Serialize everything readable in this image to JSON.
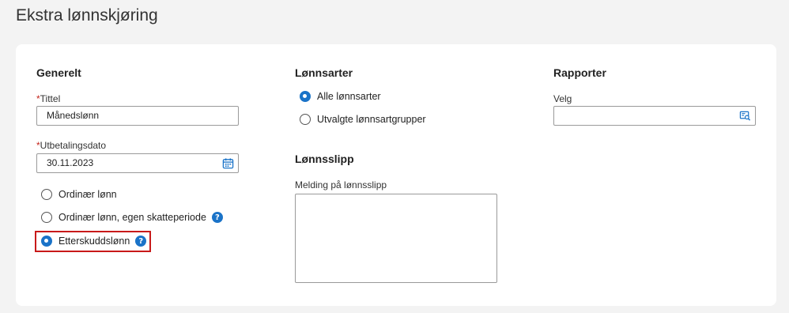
{
  "page": {
    "title": "Ekstra lønnskjøring"
  },
  "generelt": {
    "heading": "Generelt",
    "tittel": {
      "required_mark": "*",
      "label": "Tittel",
      "value": "Månedslønn"
    },
    "utbetalingsdato": {
      "required_mark": "*",
      "label": "Utbetalingsdato",
      "value": "30.11.2023",
      "icon": "calendar-icon"
    },
    "pay_types": [
      {
        "label": "Ordinær lønn",
        "checked": false,
        "help": false
      },
      {
        "label": "Ordinær lønn, egen skatteperiode",
        "checked": false,
        "help": true
      },
      {
        "label": "Etterskuddslønn",
        "checked": true,
        "help": true
      }
    ],
    "help_glyph": "?"
  },
  "lonnsarter": {
    "heading": "Lønnsarter",
    "options": [
      {
        "label": "Alle lønnsarter",
        "checked": true
      },
      {
        "label": "Utvalgte lønnsartgrupper",
        "checked": false
      }
    ]
  },
  "lonnsslipp": {
    "heading": "Lønnsslipp",
    "message_label": "Melding på lønnsslipp",
    "message_value": ""
  },
  "rapporter": {
    "heading": "Rapporter",
    "velg_label": "Velg",
    "velg_value": "",
    "icon": "lookup-icon"
  },
  "colors": {
    "accent": "#1a73c8",
    "required": "#c4261d",
    "highlight": "#c81a1a"
  }
}
